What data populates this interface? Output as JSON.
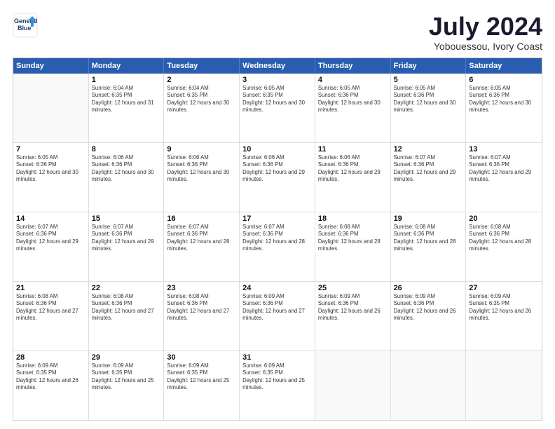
{
  "logo": {
    "line1": "General",
    "line2": "Blue"
  },
  "header": {
    "title": "July 2024",
    "subtitle": "Yobouessou, Ivory Coast"
  },
  "days": [
    "Sunday",
    "Monday",
    "Tuesday",
    "Wednesday",
    "Thursday",
    "Friday",
    "Saturday"
  ],
  "weeks": [
    [
      {
        "day": "",
        "empty": true
      },
      {
        "day": "1",
        "sunrise": "6:04 AM",
        "sunset": "6:35 PM",
        "daylight": "12 hours and 31 minutes."
      },
      {
        "day": "2",
        "sunrise": "6:04 AM",
        "sunset": "6:35 PM",
        "daylight": "12 hours and 30 minutes."
      },
      {
        "day": "3",
        "sunrise": "6:05 AM",
        "sunset": "6:35 PM",
        "daylight": "12 hours and 30 minutes."
      },
      {
        "day": "4",
        "sunrise": "6:05 AM",
        "sunset": "6:36 PM",
        "daylight": "12 hours and 30 minutes."
      },
      {
        "day": "5",
        "sunrise": "6:05 AM",
        "sunset": "6:36 PM",
        "daylight": "12 hours and 30 minutes."
      },
      {
        "day": "6",
        "sunrise": "6:05 AM",
        "sunset": "6:36 PM",
        "daylight": "12 hours and 30 minutes."
      }
    ],
    [
      {
        "day": "7",
        "sunrise": "6:05 AM",
        "sunset": "6:36 PM",
        "daylight": "12 hours and 30 minutes."
      },
      {
        "day": "8",
        "sunrise": "6:06 AM",
        "sunset": "6:36 PM",
        "daylight": "12 hours and 30 minutes."
      },
      {
        "day": "9",
        "sunrise": "6:06 AM",
        "sunset": "6:36 PM",
        "daylight": "12 hours and 30 minutes."
      },
      {
        "day": "10",
        "sunrise": "6:06 AM",
        "sunset": "6:36 PM",
        "daylight": "12 hours and 29 minutes."
      },
      {
        "day": "11",
        "sunrise": "6:06 AM",
        "sunset": "6:36 PM",
        "daylight": "12 hours and 29 minutes."
      },
      {
        "day": "12",
        "sunrise": "6:07 AM",
        "sunset": "6:36 PM",
        "daylight": "12 hours and 29 minutes."
      },
      {
        "day": "13",
        "sunrise": "6:07 AM",
        "sunset": "6:36 PM",
        "daylight": "12 hours and 29 minutes."
      }
    ],
    [
      {
        "day": "14",
        "sunrise": "6:07 AM",
        "sunset": "6:36 PM",
        "daylight": "12 hours and 29 minutes."
      },
      {
        "day": "15",
        "sunrise": "6:07 AM",
        "sunset": "6:36 PM",
        "daylight": "12 hours and 29 minutes."
      },
      {
        "day": "16",
        "sunrise": "6:07 AM",
        "sunset": "6:36 PM",
        "daylight": "12 hours and 28 minutes."
      },
      {
        "day": "17",
        "sunrise": "6:07 AM",
        "sunset": "6:36 PM",
        "daylight": "12 hours and 28 minutes."
      },
      {
        "day": "18",
        "sunrise": "6:08 AM",
        "sunset": "6:36 PM",
        "daylight": "12 hours and 28 minutes."
      },
      {
        "day": "19",
        "sunrise": "6:08 AM",
        "sunset": "6:36 PM",
        "daylight": "12 hours and 28 minutes."
      },
      {
        "day": "20",
        "sunrise": "6:08 AM",
        "sunset": "6:36 PM",
        "daylight": "12 hours and 28 minutes."
      }
    ],
    [
      {
        "day": "21",
        "sunrise": "6:08 AM",
        "sunset": "6:36 PM",
        "daylight": "12 hours and 27 minutes."
      },
      {
        "day": "22",
        "sunrise": "6:08 AM",
        "sunset": "6:36 PM",
        "daylight": "12 hours and 27 minutes."
      },
      {
        "day": "23",
        "sunrise": "6:08 AM",
        "sunset": "6:36 PM",
        "daylight": "12 hours and 27 minutes."
      },
      {
        "day": "24",
        "sunrise": "6:09 AM",
        "sunset": "6:36 PM",
        "daylight": "12 hours and 27 minutes."
      },
      {
        "day": "25",
        "sunrise": "6:09 AM",
        "sunset": "6:36 PM",
        "daylight": "12 hours and 26 minutes."
      },
      {
        "day": "26",
        "sunrise": "6:09 AM",
        "sunset": "6:36 PM",
        "daylight": "12 hours and 26 minutes."
      },
      {
        "day": "27",
        "sunrise": "6:09 AM",
        "sunset": "6:35 PM",
        "daylight": "12 hours and 26 minutes."
      }
    ],
    [
      {
        "day": "28",
        "sunrise": "6:09 AM",
        "sunset": "6:35 PM",
        "daylight": "12 hours and 26 minutes."
      },
      {
        "day": "29",
        "sunrise": "6:09 AM",
        "sunset": "6:35 PM",
        "daylight": "12 hours and 25 minutes."
      },
      {
        "day": "30",
        "sunrise": "6:09 AM",
        "sunset": "6:35 PM",
        "daylight": "12 hours and 25 minutes."
      },
      {
        "day": "31",
        "sunrise": "6:09 AM",
        "sunset": "6:35 PM",
        "daylight": "12 hours and 25 minutes."
      },
      {
        "day": "",
        "empty": true
      },
      {
        "day": "",
        "empty": true
      },
      {
        "day": "",
        "empty": true
      }
    ]
  ]
}
